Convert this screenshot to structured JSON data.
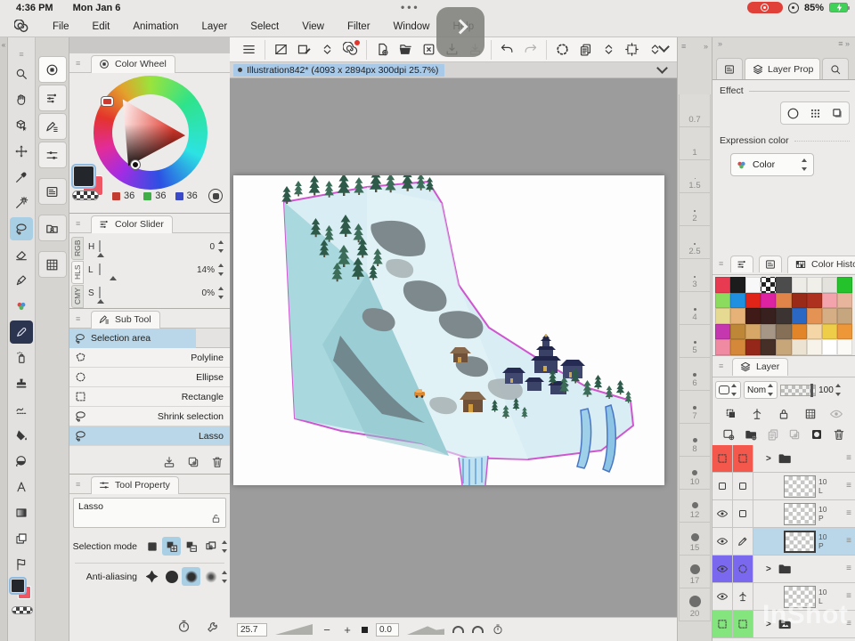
{
  "status_bar": {
    "time": "4:36 PM",
    "date": "Mon Jan 6",
    "battery": "85%"
  },
  "menu_bar": {
    "items": [
      "File",
      "Edit",
      "Animation",
      "Layer",
      "Select",
      "View",
      "Filter",
      "Window",
      "Help"
    ]
  },
  "toolbar": {
    "buttons": [
      {
        "icon": "menu",
        "name": "main-menu-button"
      },
      {
        "icon": "canvasnew",
        "name": "canvas-settings-button"
      },
      {
        "icon": "canvaspen",
        "name": "canvas-edit-button"
      },
      {
        "icon": "updown",
        "name": "canvas-stepper"
      },
      {
        "icon": "spiral",
        "name": "clip-studio-assets-button",
        "badge": true
      },
      {
        "icon": "newdoc",
        "name": "new-file-button"
      },
      {
        "icon": "open",
        "name": "open-file-button"
      },
      {
        "icon": "closex",
        "name": "close-file-button"
      },
      {
        "icon": "save",
        "name": "save-button"
      },
      {
        "icon": "import",
        "name": "export-button",
        "cls": "dis"
      },
      {
        "icon": "undo",
        "name": "undo-button"
      },
      {
        "icon": "redo",
        "name": "redo-button",
        "cls": "dis"
      },
      {
        "icon": "spin",
        "name": "snap-settings-button"
      },
      {
        "icon": "copy2",
        "name": "clipboard-button"
      },
      {
        "icon": "updown",
        "name": "clipboard-stepper"
      },
      {
        "icon": "crop",
        "name": "selection-launcher-button"
      },
      {
        "icon": "updown",
        "name": "selection-launcher-stepper"
      }
    ]
  },
  "document": {
    "title": "Illustration842* (4093 x 2894px 300dpi 25.7%)"
  },
  "left_toolbar": {
    "tools": [
      {
        "icon": "zoom",
        "name": "zoom-tool"
      },
      {
        "icon": "hand",
        "name": "hand-tool"
      },
      {
        "icon": "cube",
        "name": "operation-tool"
      },
      {
        "icon": "move",
        "name": "move-layer-tool"
      },
      {
        "icon": "dropper",
        "name": "eyedropper-tool"
      },
      {
        "icon": "wand",
        "name": "auto-select-tool"
      },
      {
        "icon": "lasso",
        "name": "selection-area-tool",
        "cls": "sel"
      },
      {
        "icon": "eraser",
        "name": "eraser-tool"
      },
      {
        "icon": "pen",
        "name": "pen-tool"
      },
      {
        "icon": "deco",
        "name": "decoration-tool"
      },
      {
        "icon": "marker",
        "name": "marker-tool",
        "cls": "dark"
      },
      {
        "icon": "spray",
        "name": "airbrush-tool"
      },
      {
        "icon": "stamp",
        "name": "stamp-tool"
      },
      {
        "icon": "blend",
        "name": "blend-tool"
      },
      {
        "icon": "fill",
        "name": "fill-tool"
      },
      {
        "icon": "gradball",
        "name": "gradient-tool"
      },
      {
        "icon": "textA",
        "name": "text-tool"
      },
      {
        "icon": "gradsq",
        "name": "gradient-map-tool"
      },
      {
        "icon": "layers2",
        "name": "layer-select-tool"
      },
      {
        "icon": "flag",
        "name": "frame-border-tool"
      }
    ],
    "panel_tabs": [
      {
        "icon": "colorwheelTab",
        "name": "panel-tab-color-wheel",
        "cls": "active"
      },
      {
        "icon": "colorsliderTab",
        "name": "panel-tab-color-slider"
      },
      {
        "icon": "subtoolTab",
        "name": "panel-tab-sub-tool"
      },
      {
        "icon": "toolpropTab",
        "name": "panel-tab-tool-property"
      },
      {
        "icon": "card",
        "name": "panel-tab-quick-access",
        "cls": "lone"
      },
      {
        "icon": "matfolder",
        "name": "panel-tab-material",
        "cls": "lone"
      },
      {
        "icon": "gridtab",
        "name": "panel-tab-pattern",
        "cls": "lone"
      }
    ]
  },
  "panels": {
    "color_wheel": {
      "tab": "Color Wheel",
      "r": "36",
      "g": "36",
      "b": "36",
      "r_color": "#c23b2f",
      "g_color": "#3fae49",
      "b_color": "#3a49c8"
    },
    "color_slider": {
      "tab": "Color Slider",
      "side_tabs": [
        {
          "label": "RGB"
        },
        {
          "label": "HLS",
          "cls": "active"
        },
        {
          "label": "CMY"
        }
      ],
      "sliders": [
        {
          "label": "H",
          "value": "0",
          "pos": "2%",
          "cls": "hue"
        },
        {
          "label": "L",
          "value": "14%",
          "pos": "16%",
          "cls": "lum"
        },
        {
          "label": "S",
          "value": "0%",
          "pos": "2%",
          "cls": "sat"
        }
      ]
    },
    "sub_tool": {
      "tab": "Sub Tool",
      "group": "Selection area",
      "items": [
        {
          "label": "Polyline",
          "icon": "dashpoly",
          "name": "subtool-polyline"
        },
        {
          "label": "Ellipse",
          "icon": "dashcirc",
          "name": "subtool-ellipse"
        },
        {
          "label": "Rectangle",
          "icon": "dashsq",
          "name": "subtool-rectangle"
        },
        {
          "label": "Shrink selection",
          "icon": "lasso",
          "name": "subtool-shrink-selection"
        },
        {
          "label": "Lasso",
          "icon": "lasso",
          "name": "subtool-lasso",
          "cls": "sel"
        }
      ]
    },
    "tool_property": {
      "tab": "Tool Property",
      "tool_name": "Lasso",
      "selection_mode_label": "Selection mode",
      "anti_aliasing_label": "Anti-aliasing",
      "selection_modes": [
        {
          "icon": "sm1",
          "name": "selection-mode-new"
        },
        {
          "icon": "sm2",
          "name": "selection-mode-add",
          "cls": "sel"
        },
        {
          "icon": "sm3",
          "name": "selection-mode-subtract"
        },
        {
          "icon": "sm4",
          "name": "selection-mode-multiple"
        }
      ],
      "anti_aliasing": [
        {
          "name": "anti-aliasing-none",
          "cls": "aa1"
        },
        {
          "name": "anti-aliasing-weak",
          "cls": "aa2"
        },
        {
          "name": "anti-aliasing-middle",
          "cls": "aa3 sel"
        },
        {
          "name": "anti-aliasing-strong",
          "cls": "aa4"
        }
      ]
    },
    "layer_property": {
      "tab": "Layer Prop",
      "effect_label": "Effect",
      "expression_label": "Expression color",
      "expression_value": "Color",
      "effect_buttons": [
        {
          "icon": "circle",
          "name": "effect-border"
        },
        {
          "icon": "tone",
          "name": "effect-tone"
        },
        {
          "icon": "layercolor",
          "name": "effect-layer-color"
        }
      ]
    },
    "color_history": {
      "tab": "Color Histo",
      "swatches": [
        "#e83a50",
        "#1c1c1c",
        "#f8f8f8",
        "repeating-conic-gradient(#222 0% 25%,#fff 0% 50%) 0 0/10px 10px",
        "#4c4c4c",
        "#eeece6",
        "#f1efe9",
        "#e4e2dd",
        "#25c32b",
        "#8bdc5e",
        "#1f8fe0",
        "#e02518",
        "#dd22a2",
        "#e08449",
        "#9a2a18",
        "#ae3120",
        "#f2a3ab",
        "#e7b59b",
        "#e6da93",
        "#e6b277",
        "#401a17",
        "#37201d",
        "#3b3432",
        "#2a68c4",
        "#e49355",
        "#d5ae86",
        "#c6a67e",
        "#c437ae",
        "#bd8737",
        "#d6a767",
        "#a69686",
        "#856f56",
        "#e28428",
        "#f5d6a6",
        "#eecd48",
        "#ee9739",
        "#ef8aa2",
        "#d58839",
        "#94271a",
        "#452f27",
        "#c7a679",
        "#ece3d2",
        "#f7f3ea",
        "#ffffff",
        "#fcfaf6"
      ]
    },
    "layer": {
      "tab": "Layer",
      "blend_mode": "Nom",
      "opacity": "100",
      "row1_icons": [
        {
          "icon": "clip",
          "name": "clip-at-layer-below"
        },
        {
          "icon": "ruler",
          "name": "reference-layer"
        },
        {
          "icon": "lock",
          "name": "lock-layer"
        },
        {
          "icon": "pixgrid",
          "name": "lock-transparent-pixels"
        },
        {
          "icon": "eye",
          "name": "show-hide-layer",
          "cls": "dis"
        }
      ],
      "row2_icons": [
        {
          "icon": "newlayer",
          "name": "new-raster-layer"
        },
        {
          "icon": "newfolder",
          "name": "new-layer-folder"
        },
        {
          "icon": "copy2",
          "name": "transfer-to-l ayer",
          "cls": "dis"
        },
        {
          "icon": "adddoc",
          "name": "combine-to-layer",
          "cls": "dis"
        },
        {
          "icon": "masksq",
          "name": "create-layer-mask"
        },
        {
          "icon": "trash",
          "name": "delete-layer"
        }
      ],
      "layers": [
        {
          "cls": "folder",
          "tint": "#f4574b",
          "c1": "dashsq",
          "c2": "dashsq",
          "ficon": "folder",
          "name": "layer-folder-red"
        },
        {
          "cls": "layer",
          "c1": "box",
          "c2": "box",
          "top": "10",
          "bottom": "L",
          "name": "layer-row-1"
        },
        {
          "cls": "layer",
          "c1": "eye",
          "c2": "box",
          "top": "10",
          "bottom": "P",
          "name": "layer-row-2"
        },
        {
          "cls": "layer sel",
          "c1": "eye",
          "c2": "pencil",
          "top": "10",
          "bottom": "P",
          "name": "layer-row-selected"
        },
        {
          "cls": "folder",
          "tint": "#7a68ef",
          "c1": "eye",
          "c2": "dashcirc",
          "ficon": "folder",
          "name": "layer-folder-purple"
        },
        {
          "cls": "layer",
          "c1": "eye",
          "c2": "ruler",
          "top": "10",
          "bottom": "L",
          "name": "layer-row-3"
        },
        {
          "cls": "folder",
          "tint": "#84e47d",
          "c1": "dashsq",
          "c2": "dashsq",
          "ficon": "folderimg",
          "name": "layer-folder-green"
        }
      ]
    }
  },
  "brush_sizes": [
    {
      "label": "0.7",
      "dot": "0px"
    },
    {
      "label": "1",
      "dot": "0px"
    },
    {
      "label": "1.5",
      "dot": "1px"
    },
    {
      "label": "2",
      "dot": "2px"
    },
    {
      "label": "2.5",
      "dot": "2px"
    },
    {
      "label": "3",
      "dot": "2px"
    },
    {
      "label": "4",
      "dot": "3px"
    },
    {
      "label": "5",
      "dot": "3px"
    },
    {
      "label": "6",
      "dot": "4px"
    },
    {
      "label": "7",
      "dot": "4px"
    },
    {
      "label": "8",
      "dot": "5px"
    },
    {
      "label": "10",
      "dot": "6px"
    },
    {
      "label": "12",
      "dot": "7px"
    },
    {
      "label": "15",
      "dot": "9px"
    },
    {
      "label": "17",
      "dot": "11px"
    },
    {
      "label": "20",
      "dot": "13px"
    }
  ],
  "navigator": {
    "zoom": "25.7",
    "rotation": "0.0"
  },
  "watermark": "InShot"
}
